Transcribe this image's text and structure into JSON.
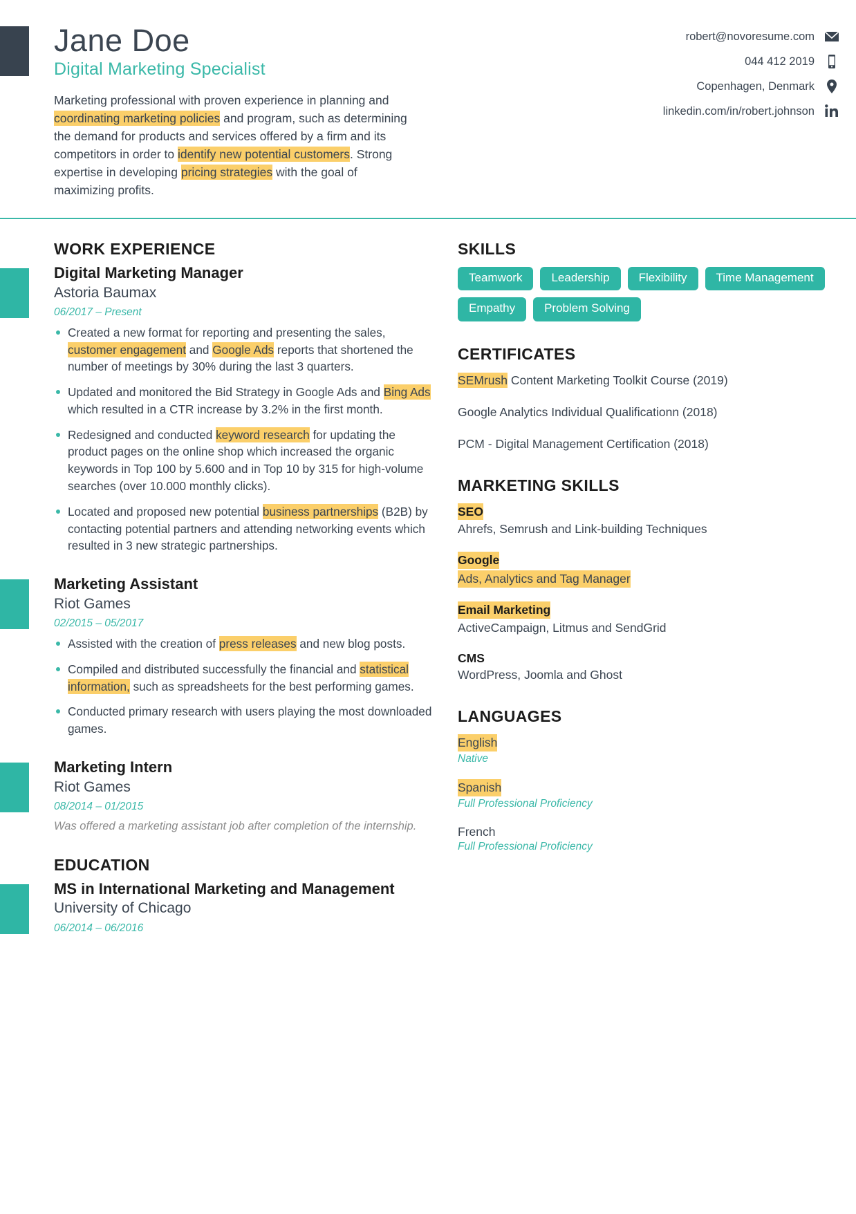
{
  "header": {
    "name": "Jane Doe",
    "title": "Digital Marketing Specialist",
    "summary_parts": [
      {
        "text": "Marketing professional with proven experience in planning and ",
        "hl": false
      },
      {
        "text": "coordinating marketing policies",
        "hl": true
      },
      {
        "text": " and program, such as determining the demand for products and services offered by a firm and its competitors in order to ",
        "hl": false
      },
      {
        "text": "identify new potential customers",
        "hl": true
      },
      {
        "text": ". Strong expertise in developing ",
        "hl": false
      },
      {
        "text": "pricing strategies",
        "hl": true
      },
      {
        "text": " with the goal of maximizing profits.",
        "hl": false
      }
    ],
    "contacts": [
      {
        "text": "robert@novoresume.com",
        "icon": "envelope-icon"
      },
      {
        "text": "044 412 2019",
        "icon": "phone-icon"
      },
      {
        "text": "Copenhagen, Denmark",
        "icon": "location-pin-icon"
      },
      {
        "text": "linkedin.com/in/robert.johnson",
        "icon": "linkedin-icon"
      }
    ]
  },
  "work": {
    "heading": "WORK EXPERIENCE",
    "entries": [
      {
        "role": "Digital Marketing Manager",
        "company": "Astoria Baumax",
        "dates": "06/2017 – Present",
        "bullets": [
          [
            {
              "text": "Created a new format for reporting and presenting the sales, ",
              "hl": false
            },
            {
              "text": "customer engagement",
              "hl": true
            },
            {
              "text": " and ",
              "hl": false
            },
            {
              "text": "Google Ads",
              "hl": true
            },
            {
              "text": " reports that shortened the number of meetings by 30% during the last 3 quarters.",
              "hl": false
            }
          ],
          [
            {
              "text": "Updated and monitored the Bid Strategy in Google Ads and ",
              "hl": false
            },
            {
              "text": "Bing Ads",
              "hl": true
            },
            {
              "text": " which resulted in a CTR increase by 3.2% in the first month.",
              "hl": false
            }
          ],
          [
            {
              "text": "Redesigned and conducted ",
              "hl": false
            },
            {
              "text": "keyword research",
              "hl": true
            },
            {
              "text": " for updating the product pages on the online shop which increased the organic keywords in Top 100 by 5.600 and in Top 10 by 315 for high-volume searches (over 10.000 monthly clicks).",
              "hl": false
            }
          ],
          [
            {
              "text": "Located and proposed new potential ",
              "hl": false
            },
            {
              "text": "business partnerships",
              "hl": true
            },
            {
              "text": " (B2B) by contacting potential partners and attending networking events which resulted in 3 new strategic partnerships.",
              "hl": false
            }
          ]
        ],
        "note": ""
      },
      {
        "role": "Marketing Assistant",
        "company": "Riot Games",
        "dates": "02/2015 – 05/2017",
        "bullets": [
          [
            {
              "text": "Assisted with the creation of ",
              "hl": false
            },
            {
              "text": "press releases",
              "hl": true
            },
            {
              "text": " and new blog posts.",
              "hl": false
            }
          ],
          [
            {
              "text": "Compiled and distributed successfully the financial and ",
              "hl": false
            },
            {
              "text": "statistical information,",
              "hl": true
            },
            {
              "text": " such as spreadsheets for the best performing games.",
              "hl": false
            }
          ],
          [
            {
              "text": "Conducted primary research with users playing the most downloaded games.",
              "hl": false
            }
          ]
        ],
        "note": ""
      },
      {
        "role": "Marketing Intern",
        "company": "Riot Games",
        "dates": "08/2014 – 01/2015",
        "bullets": [],
        "note": "Was offered a marketing assistant job after completion of the internship."
      }
    ]
  },
  "education": {
    "heading": "EDUCATION",
    "degree": "MS in International Marketing and Management",
    "school": "University of Chicago",
    "dates": "06/2014 – 06/2016"
  },
  "skills": {
    "heading": "SKILLS",
    "items": [
      "Teamwork",
      "Leadership",
      "Flexibility",
      "Time Management",
      "Empathy",
      "Problem Solving"
    ]
  },
  "certificates": {
    "heading": "CERTIFICATES",
    "items": [
      [
        {
          "text": "SEMrush",
          "hl": true
        },
        {
          "text": " Content Marketing Toolkit Course (2019)",
          "hl": false
        }
      ],
      [
        {
          "text": "Google Analytics Individual Qualificationn (2018)",
          "hl": false
        }
      ],
      [
        {
          "text": "PCM - Digital Management Certification (2018)",
          "hl": false
        }
      ]
    ]
  },
  "marketing_skills": {
    "heading": "MARKETING SKILLS",
    "items": [
      {
        "label": "SEO",
        "label_hl": true,
        "desc": "Ahrefs, Semrush and Link-building Techniques",
        "desc_hl": false
      },
      {
        "label": "Google",
        "label_hl": true,
        "desc": "Ads, Analytics and Tag Manager",
        "desc_hl": true
      },
      {
        "label": "Email Marketing",
        "label_hl": true,
        "desc": "ActiveCampaign, Litmus and SendGrid",
        "desc_hl": false
      },
      {
        "label": "CMS",
        "label_hl": false,
        "desc": "WordPress, Joomla and Ghost",
        "desc_hl": false
      }
    ]
  },
  "languages": {
    "heading": "LANGUAGES",
    "items": [
      {
        "name": "English",
        "name_hl": true,
        "level": "Native"
      },
      {
        "name": "Spanish",
        "name_hl": true,
        "level": "Full Professional Proficiency"
      },
      {
        "name": "French",
        "name_hl": false,
        "level": "Full Professional Proficiency"
      }
    ]
  },
  "colors": {
    "accent_teal": "#2fb6a5",
    "accent_teal_text": "#3ab8a8",
    "dark_navy": "#38434f",
    "highlight_yellow": "#fbcf6a",
    "body_text": "#3b4551"
  }
}
